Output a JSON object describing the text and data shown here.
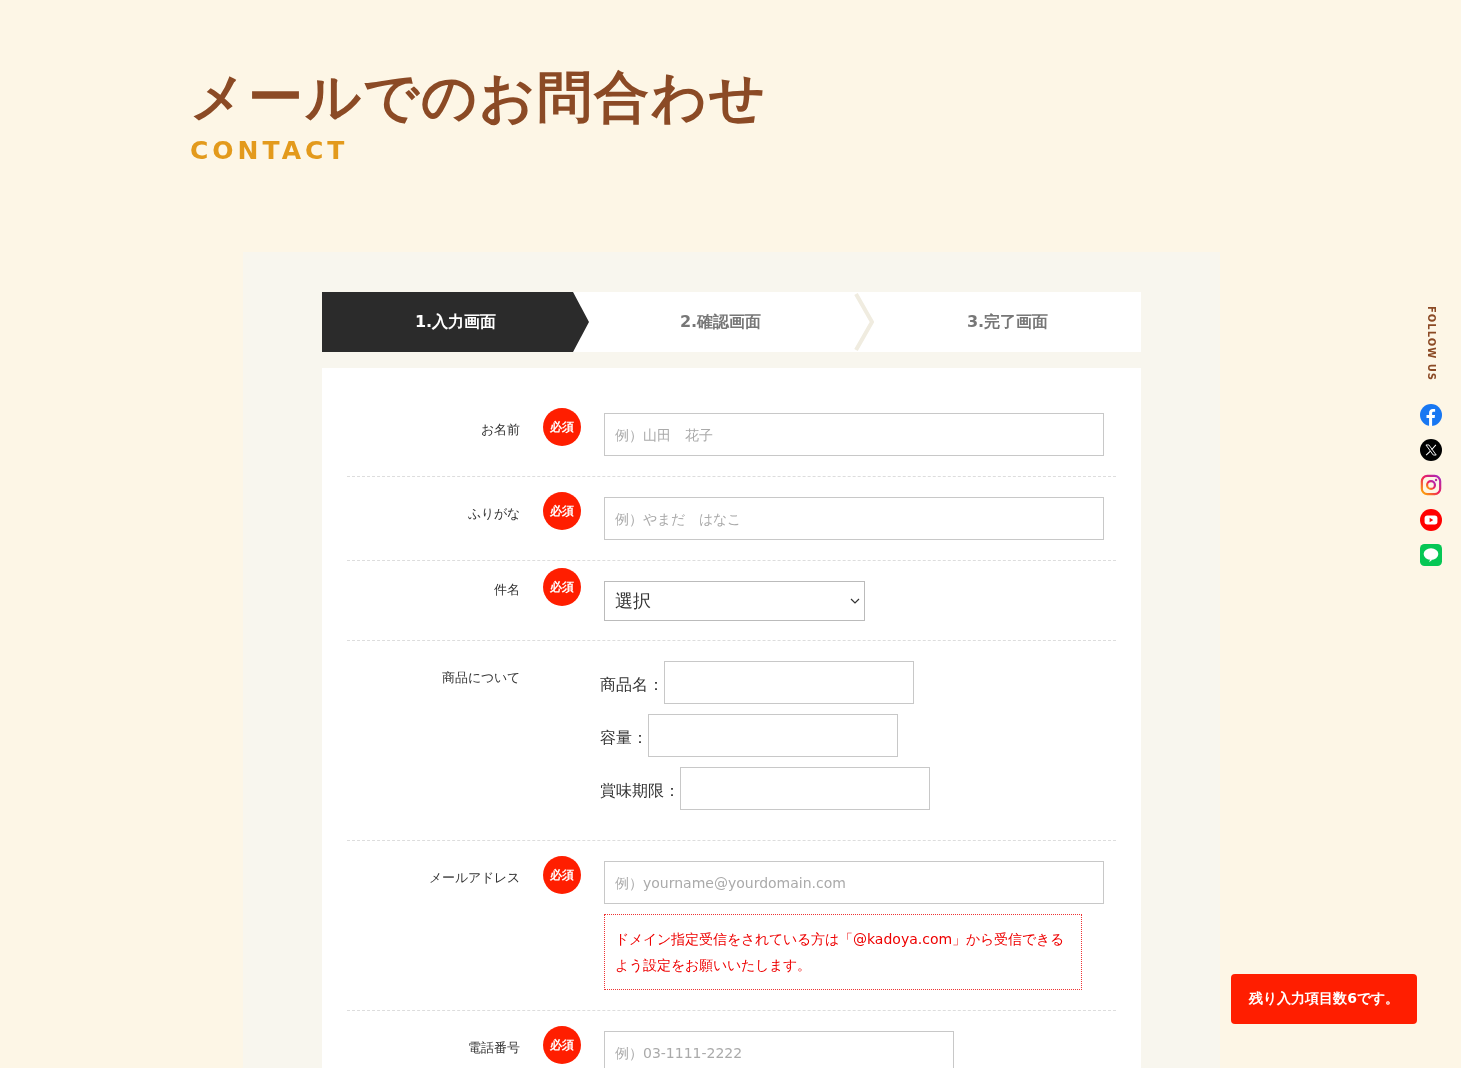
{
  "header": {
    "title": "メールでのお問合わせ",
    "subtitle": "CONTACT"
  },
  "steps": [
    {
      "label": "1.入力画面",
      "selected": true
    },
    {
      "label": "2.確認画面",
      "selected": false
    },
    {
      "label": "3.完了画面",
      "selected": false
    }
  ],
  "form": [
    {
      "kind": "text",
      "label": "お名前",
      "badge": "必須",
      "placeholder": "例）山田　花子"
    },
    {
      "kind": "text",
      "label": "ふりがな",
      "badge": "必須",
      "placeholder": "例）やまだ　はなこ"
    },
    {
      "kind": "select",
      "label": "件名",
      "badge": "必須",
      "value": "選択"
    },
    {
      "kind": "group",
      "label": "商品について",
      "fields": [
        {
          "label": "商品名："
        },
        {
          "label": "容量："
        },
        {
          "label": "賞味期限："
        }
      ]
    },
    {
      "kind": "email",
      "label": "メールアドレス",
      "badge": "必須",
      "placeholder": "例）yourname@yourdomain.com",
      "note": "ドメイン指定受信をされている方は「@kadoya.com」から受信できるよう設定をお願いいたします。"
    },
    {
      "kind": "short",
      "label": "電話番号",
      "badge": "必須",
      "placeholder": "例）03-1111-2222"
    }
  ],
  "social": {
    "title": "FOLLOW US"
  },
  "notice": "残り入力項目数6です。"
}
